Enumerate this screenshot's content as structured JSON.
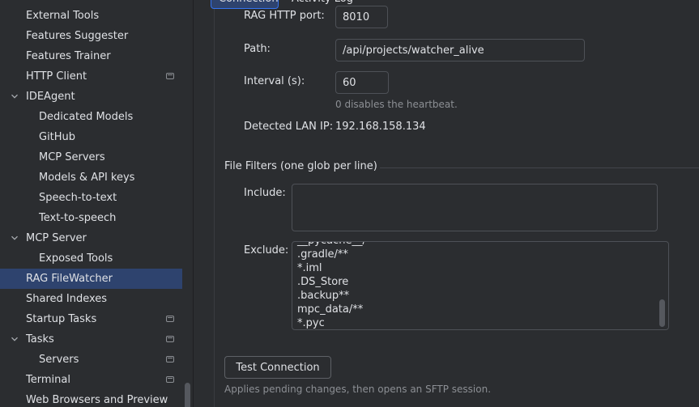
{
  "sidebar": {
    "items": [
      {
        "label": "External Tools",
        "indent": 1,
        "badge": false,
        "chevron": false,
        "selected": false
      },
      {
        "label": "Features Suggester",
        "indent": 1,
        "badge": false,
        "chevron": false,
        "selected": false
      },
      {
        "label": "Features Trainer",
        "indent": 1,
        "badge": false,
        "chevron": false,
        "selected": false
      },
      {
        "label": "HTTP Client",
        "indent": 1,
        "badge": true,
        "chevron": false,
        "selected": false
      },
      {
        "label": "IDEAgent",
        "indent": 1,
        "badge": false,
        "chevron": true,
        "selected": false
      },
      {
        "label": "Dedicated Models",
        "indent": 2,
        "badge": false,
        "chevron": false,
        "selected": false
      },
      {
        "label": "GitHub",
        "indent": 2,
        "badge": false,
        "chevron": false,
        "selected": false
      },
      {
        "label": "MCP Servers",
        "indent": 2,
        "badge": false,
        "chevron": false,
        "selected": false
      },
      {
        "label": "Models & API keys",
        "indent": 2,
        "badge": false,
        "chevron": false,
        "selected": false
      },
      {
        "label": "Speech-to-text",
        "indent": 2,
        "badge": false,
        "chevron": false,
        "selected": false
      },
      {
        "label": "Text-to-speech",
        "indent": 2,
        "badge": false,
        "chevron": false,
        "selected": false
      },
      {
        "label": "MCP Server",
        "indent": 1,
        "badge": false,
        "chevron": true,
        "selected": false
      },
      {
        "label": "Exposed Tools",
        "indent": 2,
        "badge": false,
        "chevron": false,
        "selected": false
      },
      {
        "label": "RAG FileWatcher",
        "indent": 1,
        "badge": false,
        "chevron": false,
        "selected": true
      },
      {
        "label": "Shared Indexes",
        "indent": 1,
        "badge": false,
        "chevron": false,
        "selected": false
      },
      {
        "label": "Startup Tasks",
        "indent": 1,
        "badge": true,
        "chevron": false,
        "selected": false
      },
      {
        "label": "Tasks",
        "indent": 1,
        "badge": true,
        "chevron": true,
        "selected": false
      },
      {
        "label": "Servers",
        "indent": 2,
        "badge": true,
        "chevron": false,
        "selected": false
      },
      {
        "label": "Terminal",
        "indent": 1,
        "badge": true,
        "chevron": false,
        "selected": false
      },
      {
        "label": "Web Browsers and Preview",
        "indent": 1,
        "badge": false,
        "chevron": false,
        "selected": false
      }
    ]
  },
  "tabs": {
    "active": "Connection",
    "inactive": "Activity Log"
  },
  "form": {
    "port_label": "RAG HTTP port:",
    "port_value": "8010",
    "path_label": "Path:",
    "path_value": "/api/projects/watcher_alive",
    "interval_label": "Interval (s):",
    "interval_value": "60",
    "interval_hint": "0 disables the heartbeat.",
    "lan_label": "Detected LAN IP:",
    "lan_value": "192.168.158.134"
  },
  "filters": {
    "title": "File Filters (one glob per line)",
    "include_label": "Include:",
    "include_value": "",
    "exclude_label": "Exclude:",
    "exclude_lines": [
      "__pycache__/",
      ".gradle/**",
      "*.iml",
      ".DS_Store",
      ".backup**",
      "mpc_data/**",
      "*.pyc"
    ]
  },
  "actions": {
    "test_button": "Test Connection",
    "test_hint": "Applies pending changes, then opens an SFTP session."
  },
  "colors": {
    "background": "#2b2d30",
    "selection": "#2e436e",
    "accent_border": "#3574f0",
    "text": "#dfe1e5",
    "hint": "#8c8f94"
  }
}
